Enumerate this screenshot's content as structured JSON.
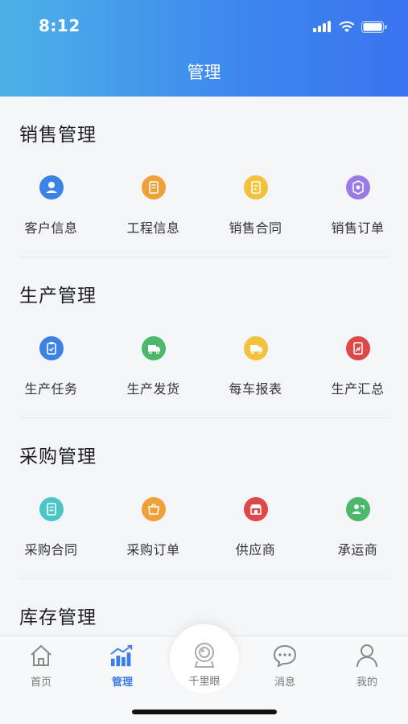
{
  "status_bar": {
    "time": "8:12"
  },
  "header": {
    "title": "管理"
  },
  "sections": [
    {
      "title": "销售管理",
      "items": [
        {
          "label": "客户信息",
          "icon": "customer-icon",
          "color": "#3b82e6"
        },
        {
          "label": "工程信息",
          "icon": "project-icon",
          "color": "#f0a038"
        },
        {
          "label": "销售合同",
          "icon": "contract-icon",
          "color": "#f4c23a"
        },
        {
          "label": "销售订单",
          "icon": "order-icon",
          "color": "#9a7ae6"
        }
      ]
    },
    {
      "title": "生产管理",
      "items": [
        {
          "label": "生产任务",
          "icon": "task-icon",
          "color": "#3b82e6"
        },
        {
          "label": "生产发货",
          "icon": "delivery-icon",
          "color": "#4cb86a"
        },
        {
          "label": "每车报表",
          "icon": "truck-report-icon",
          "color": "#f4c23a"
        },
        {
          "label": "生产汇总",
          "icon": "summary-icon",
          "color": "#e04848"
        }
      ]
    },
    {
      "title": "采购管理",
      "items": [
        {
          "label": "采购合同",
          "icon": "purchase-contract-icon",
          "color": "#4ac6c8"
        },
        {
          "label": "采购订单",
          "icon": "purchase-order-icon",
          "color": "#f0a038"
        },
        {
          "label": "供应商",
          "icon": "supplier-icon",
          "color": "#e04848"
        },
        {
          "label": "承运商",
          "icon": "carrier-icon",
          "color": "#4cb86a"
        }
      ]
    },
    {
      "title": "库存管理",
      "items": []
    }
  ],
  "tabbar": {
    "home": "首页",
    "manage": "管理",
    "eye": "千里眼",
    "messages": "消息",
    "mine": "我的"
  }
}
